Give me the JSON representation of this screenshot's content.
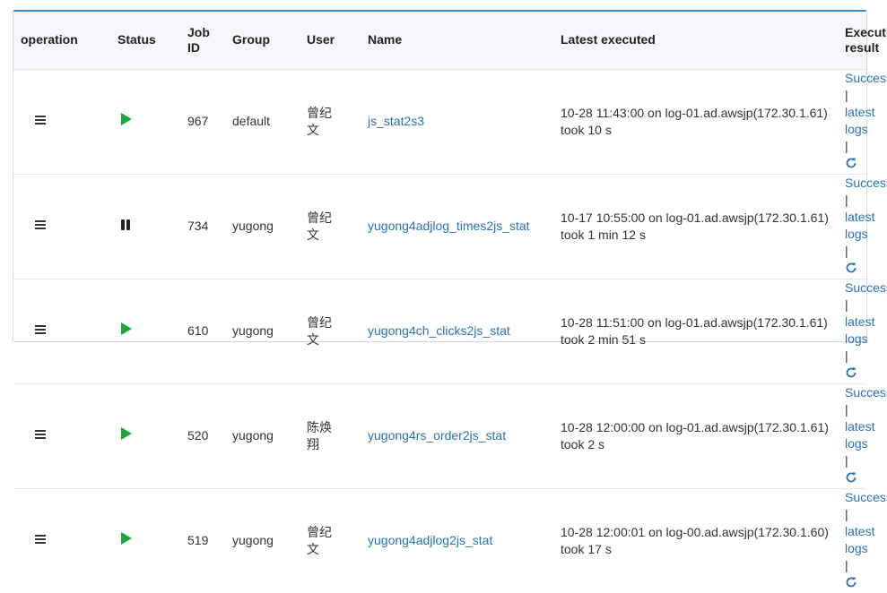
{
  "headers": {
    "operation": "operation",
    "status": "Status",
    "job_id": "Job ID",
    "group": "Group",
    "user": "User",
    "name": "Name",
    "latest": "Latest executed",
    "result": "Executing result"
  },
  "rows": [
    {
      "status": "play",
      "id": "967",
      "group": "default",
      "user": "曾纪文",
      "name": "js_stat2s3",
      "latest": "10-28 11:43:00 on log-01.ad.awsjp(172.30.1.61) took 10 s",
      "result_success": "Successed",
      "sep1": " | ",
      "result_logs": "latest logs",
      "sep2": " | "
    },
    {
      "status": "pause",
      "id": "734",
      "group": "yugong",
      "user": "曾纪文",
      "name": "yugong4adjlog_times2js_stat",
      "latest": "10-17 10:55:00 on log-01.ad.awsjp(172.30.1.61) took 1 min 12 s",
      "result_success": "Successed",
      "sep1": " | ",
      "result_logs": "latest logs",
      "sep2": " | "
    },
    {
      "status": "play",
      "id": "610",
      "group": "yugong",
      "user": "曾纪文",
      "name": "yugong4ch_clicks2js_stat",
      "latest": "10-28 11:51:00 on log-01.ad.awsjp(172.30.1.61) took 2 min 51 s",
      "result_success": "Successed",
      "sep1": " | ",
      "result_logs": "latest logs",
      "sep2": " | "
    },
    {
      "status": "play",
      "id": "520",
      "group": "yugong",
      "user": "陈焕翔",
      "name": "yugong4rs_order2js_stat",
      "latest": "10-28 12:00:00 on log-01.ad.awsjp(172.30.1.61) took 2 s",
      "result_success": "Successed",
      "sep1": " | ",
      "result_logs": "latest logs",
      "sep2": " | "
    },
    {
      "status": "play",
      "id": "519",
      "group": "yugong",
      "user": "曾纪文",
      "name": "yugong4adjlog2js_stat",
      "latest": "10-28 12:00:01 on log-00.ad.awsjp(172.30.1.60) took 17 s",
      "result_success": "Successed",
      "sep1": " | ",
      "result_logs": "latest logs",
      "sep2": " | "
    }
  ],
  "colors": {
    "accent": "#3c8dbc",
    "link": "#2a72b5",
    "running": "#1aaa38"
  }
}
